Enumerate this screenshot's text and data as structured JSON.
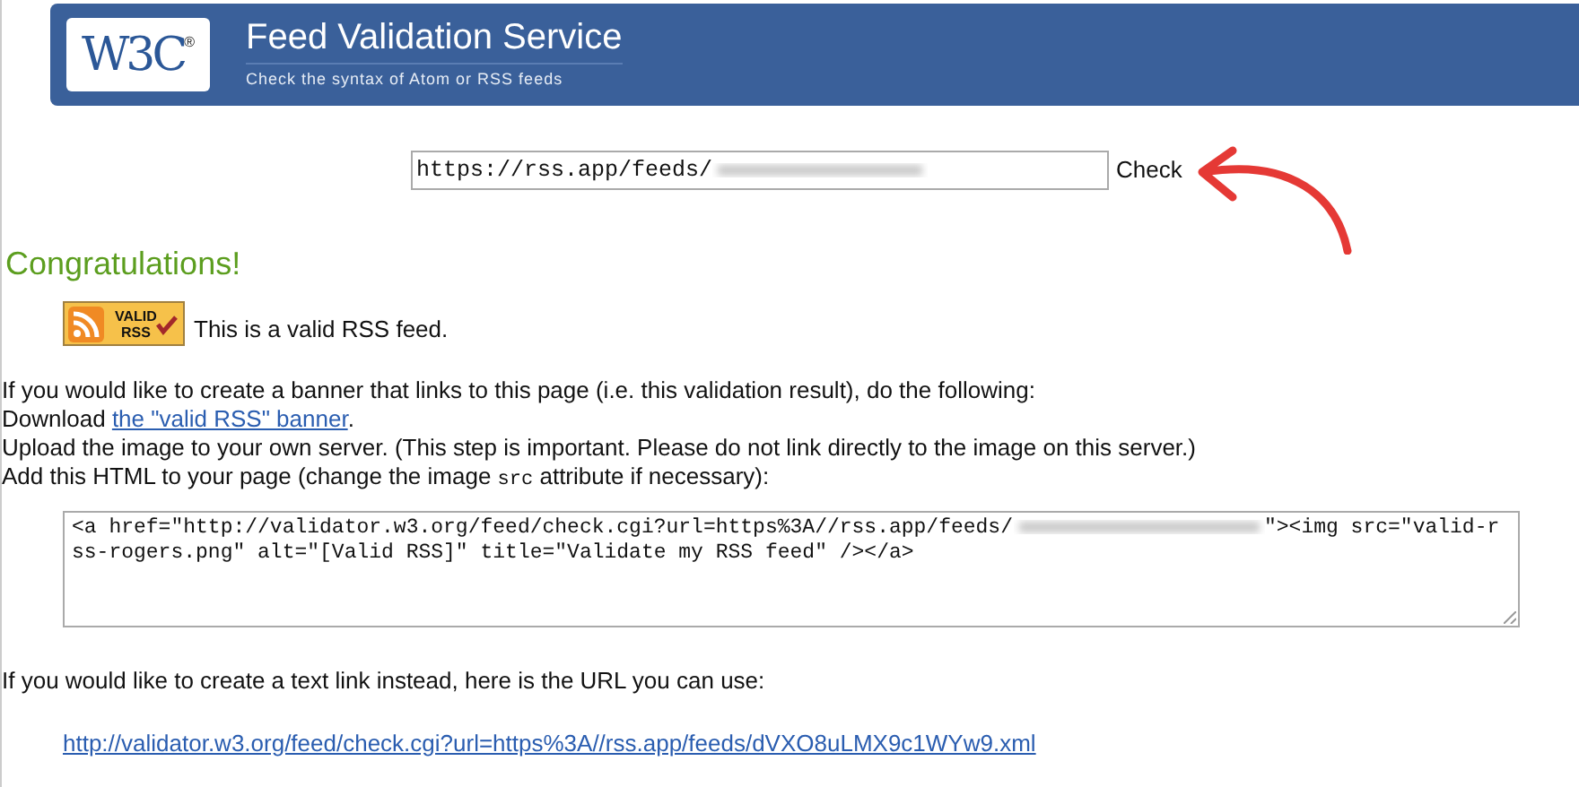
{
  "header": {
    "logo": "W3C",
    "logo_mark": "®",
    "title": "Feed Validation Service",
    "subtitle": "Check the syntax of Atom or RSS feeds"
  },
  "form": {
    "url_value": "https://rss.app/feeds/",
    "button": "Check"
  },
  "result": {
    "heading": "Congratulations!",
    "badge_top": "VALID",
    "badge_bottom": "RSS",
    "message": "This is a valid RSS feed."
  },
  "instructions": {
    "intro": "If you would like to create a banner that links to this page (i.e. this validation result), do the following:",
    "download_prefix": "Download ",
    "download_link": "the \"valid RSS\" banner",
    "download_suffix": ".",
    "upload": "Upload the image to your own server. (This step is important. Please do not link directly to the image on this server.)",
    "add_before": "Add this HTML to your page (change the image ",
    "add_code": "src",
    "add_after": " attribute if necessary):"
  },
  "code": {
    "before": "<a href=\"http://validator.w3.org/feed/check.cgi?url=https%3A//rss.app/feeds/",
    "after": "\"><img src=\"valid-rss-rogers.png\" alt=\"[Valid RSS]\" title=\"Validate my RSS feed\" /></a>"
  },
  "text_link": {
    "intro": "If you would like to create a text link instead, here is the URL you can use:",
    "url": "http://validator.w3.org/feed/check.cgi?url=https%3A//rss.app/feeds/dVXO8uLMX9c1WYw9.xml"
  }
}
